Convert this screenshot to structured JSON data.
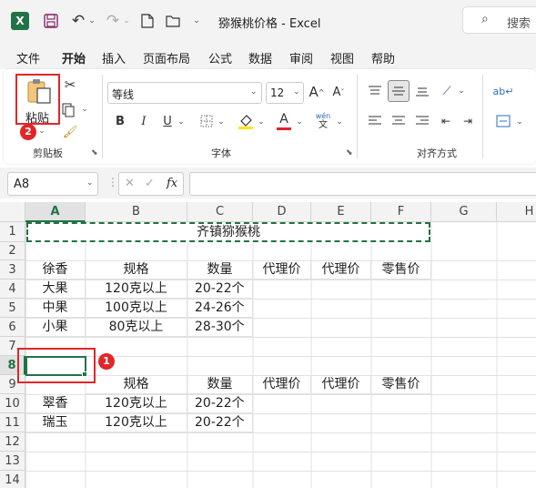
{
  "window": {
    "file_name": "猕猴桃价格",
    "separator": "-",
    "app_name": "Excel",
    "search_placeholder": "搜索"
  },
  "menu_tabs": [
    "文件",
    "开始",
    "插入",
    "页面布局",
    "公式",
    "数据",
    "审阅",
    "视图",
    "帮助"
  ],
  "active_tab": "开始",
  "ribbon": {
    "clipboard": {
      "paste_label": "粘贴",
      "group_label": "剪贴板"
    },
    "font": {
      "font_name": "等线",
      "font_size": "12",
      "group_label": "字体",
      "bold": "B",
      "italic": "I",
      "underline": "U",
      "grow": "A",
      "shrink": "A",
      "font_color_letter": "A",
      "phonetic": "wén"
    },
    "alignment": {
      "group_label": "对齐方式"
    }
  },
  "formula_bar": {
    "name_box": "A8",
    "fx": "fx",
    "cancel": "✕",
    "enter": "✓",
    "formula": ""
  },
  "columns": [
    "A",
    "B",
    "C",
    "D",
    "E",
    "F",
    "G",
    "H"
  ],
  "rows": [
    "1",
    "2",
    "3",
    "4",
    "5",
    "6",
    "7",
    "8",
    "9",
    "10",
    "11",
    "12",
    "13",
    "14"
  ],
  "cells": {
    "r1_title": "齐镇猕猴桃",
    "r3": [
      "徐香",
      "规格",
      "数量",
      "代理价",
      "代理价",
      "零售价"
    ],
    "r4": [
      "大果",
      "120克以上",
      "20-22个"
    ],
    "r5": [
      "中果",
      "100克以上",
      "24-26个"
    ],
    "r6": [
      "小果",
      "80克以上",
      "28-30个"
    ],
    "r9": [
      "",
      "规格",
      "数量",
      "代理价",
      "代理价",
      "零售价"
    ],
    "r10": [
      "翠香",
      "120克以上",
      "20-22个"
    ],
    "r11": [
      "瑞玉",
      "120克以上",
      "20-22个"
    ]
  },
  "annotations": {
    "step1": "1",
    "step2": "2",
    "highlight_color": "#e0262a"
  },
  "colors": {
    "excel_green": "#217346",
    "font_color_bar": "#e0262a",
    "fill_color_bar": "#ffe600",
    "marquee": "#217346"
  }
}
